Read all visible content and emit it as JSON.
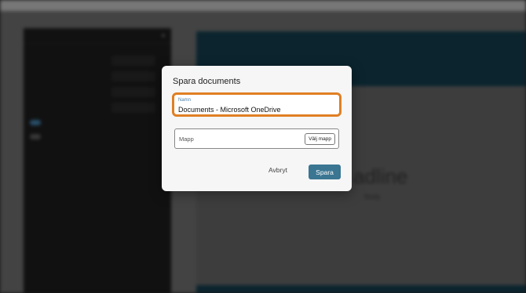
{
  "modal": {
    "title": "Spara documents",
    "name_field": {
      "label": "Namn",
      "value": "Documents - Microsoft OneDrive"
    },
    "folder_field": {
      "label": "Mapp",
      "choose_button": "Välj mapp"
    },
    "cancel_label": "Avbryt",
    "save_label": "Spara",
    "accent_color": "#e07f24",
    "primary_color": "#3a7592"
  },
  "background": {
    "canvas": {
      "headline": "adline",
      "body": "Body"
    }
  }
}
